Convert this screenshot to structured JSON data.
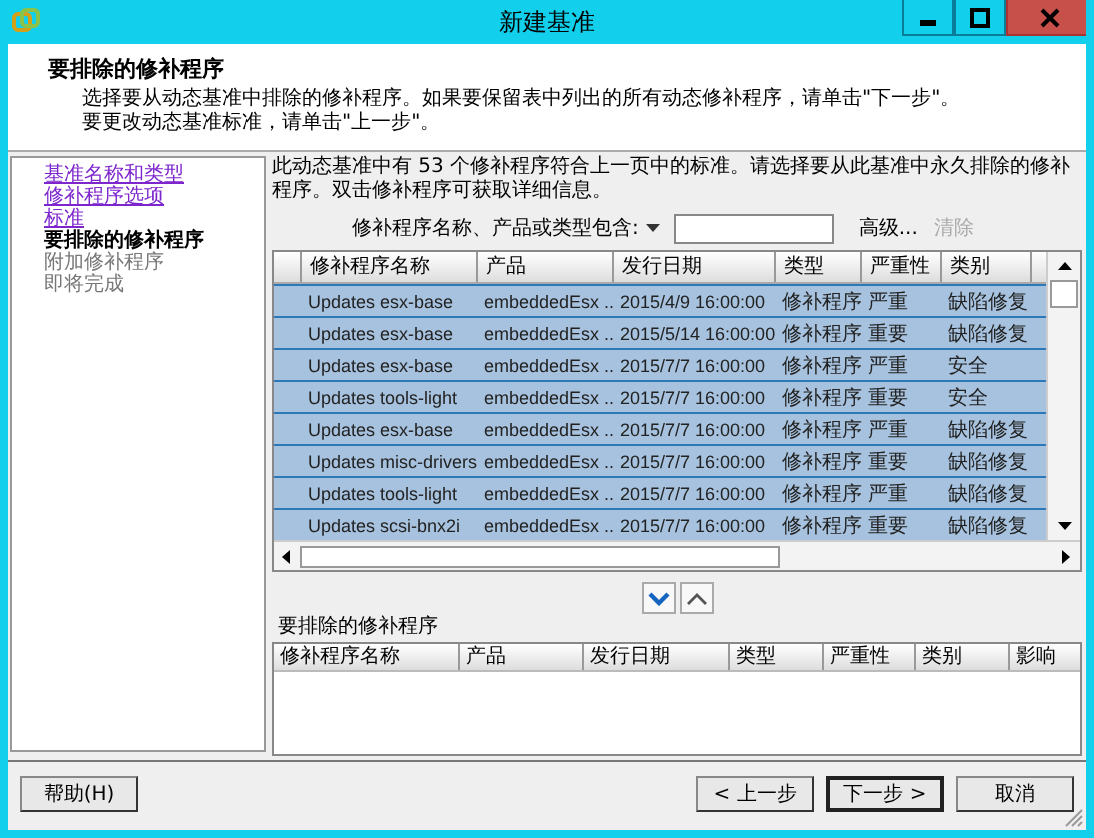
{
  "window": {
    "title": "新建基准"
  },
  "header": {
    "title": "要排除的修补程序",
    "description": [
      "选择要从动态基准中排除的修补程序。如果要保留表中列出的所有动态修补程序，请单击\"下一步\"。",
      "要更改动态基准标准，请单击\"上一步\"。"
    ]
  },
  "sidebar": {
    "items": [
      {
        "label": "基准名称和类型",
        "kind": "link"
      },
      {
        "label": "修补程序选项",
        "kind": "link"
      },
      {
        "label": "标准",
        "kind": "link"
      },
      {
        "label": "要排除的修补程序",
        "kind": "current"
      },
      {
        "label": "附加修补程序",
        "kind": "pending"
      },
      {
        "label": "即将完成",
        "kind": "pending"
      }
    ]
  },
  "intro": "此动态基准中有 53 个修补程序符合上一页中的标准。请选择要从此基准中永久排除的修补程序。双击修补程序可获取详细信息。",
  "filter": {
    "label": "修补程序名称、产品或类型包含:",
    "advanced": "高级...",
    "clear": "清除",
    "clear_disabled": true
  },
  "table": {
    "columns": [
      "修补程序名称",
      "产品",
      "发行日期",
      "类型",
      "严重性",
      "类别"
    ],
    "rows": [
      {
        "cells": [
          "Updates esx-base",
          "embeddedEsx ..",
          "2015/4/9 16:00:00",
          "修补程序",
          "严重",
          "缺陷修复"
        ],
        "selected": true
      },
      {
        "cells": [
          "Updates esx-base",
          "embeddedEsx ..",
          "2015/5/14 16:00:00",
          "修补程序",
          "重要",
          "缺陷修复"
        ],
        "selected": true
      },
      {
        "cells": [
          "Updates esx-base",
          "embeddedEsx ..",
          "2015/7/7 16:00:00",
          "修补程序",
          "严重",
          "安全"
        ],
        "selected": true
      },
      {
        "cells": [
          "Updates tools-light",
          "embeddedEsx ..",
          "2015/7/7 16:00:00",
          "修补程序",
          "重要",
          "安全"
        ],
        "selected": true
      },
      {
        "cells": [
          "Updates esx-base",
          "embeddedEsx ..",
          "2015/7/7 16:00:00",
          "修补程序",
          "严重",
          "缺陷修复"
        ],
        "selected": true
      },
      {
        "cells": [
          "Updates misc-drivers",
          "embeddedEsx ..",
          "2015/7/7 16:00:00",
          "修补程序",
          "重要",
          "缺陷修复"
        ],
        "selected": true
      },
      {
        "cells": [
          "Updates tools-light",
          "embeddedEsx ..",
          "2015/7/7 16:00:00",
          "修补程序",
          "严重",
          "缺陷修复"
        ],
        "selected": true
      },
      {
        "cells": [
          "Updates scsi-bnx2i",
          "embeddedEsx ..",
          "2015/7/7 16:00:00",
          "修补程序",
          "重要",
          "缺陷修复"
        ],
        "selected": true
      }
    ]
  },
  "excluded": {
    "label": "要排除的修补程序",
    "columns": [
      "修补程序名称",
      "产品",
      "发行日期",
      "类型",
      "严重性",
      "类别",
      "影响"
    ]
  },
  "buttons": [
    {
      "label": "帮助(H)",
      "kind": "help",
      "default": false
    },
    {
      "label": "< 上一步",
      "kind": "nav",
      "default": false
    },
    {
      "label": "下一步 >",
      "kind": "nav",
      "default": true
    },
    {
      "label": "取消",
      "kind": "nav",
      "default": false
    }
  ]
}
